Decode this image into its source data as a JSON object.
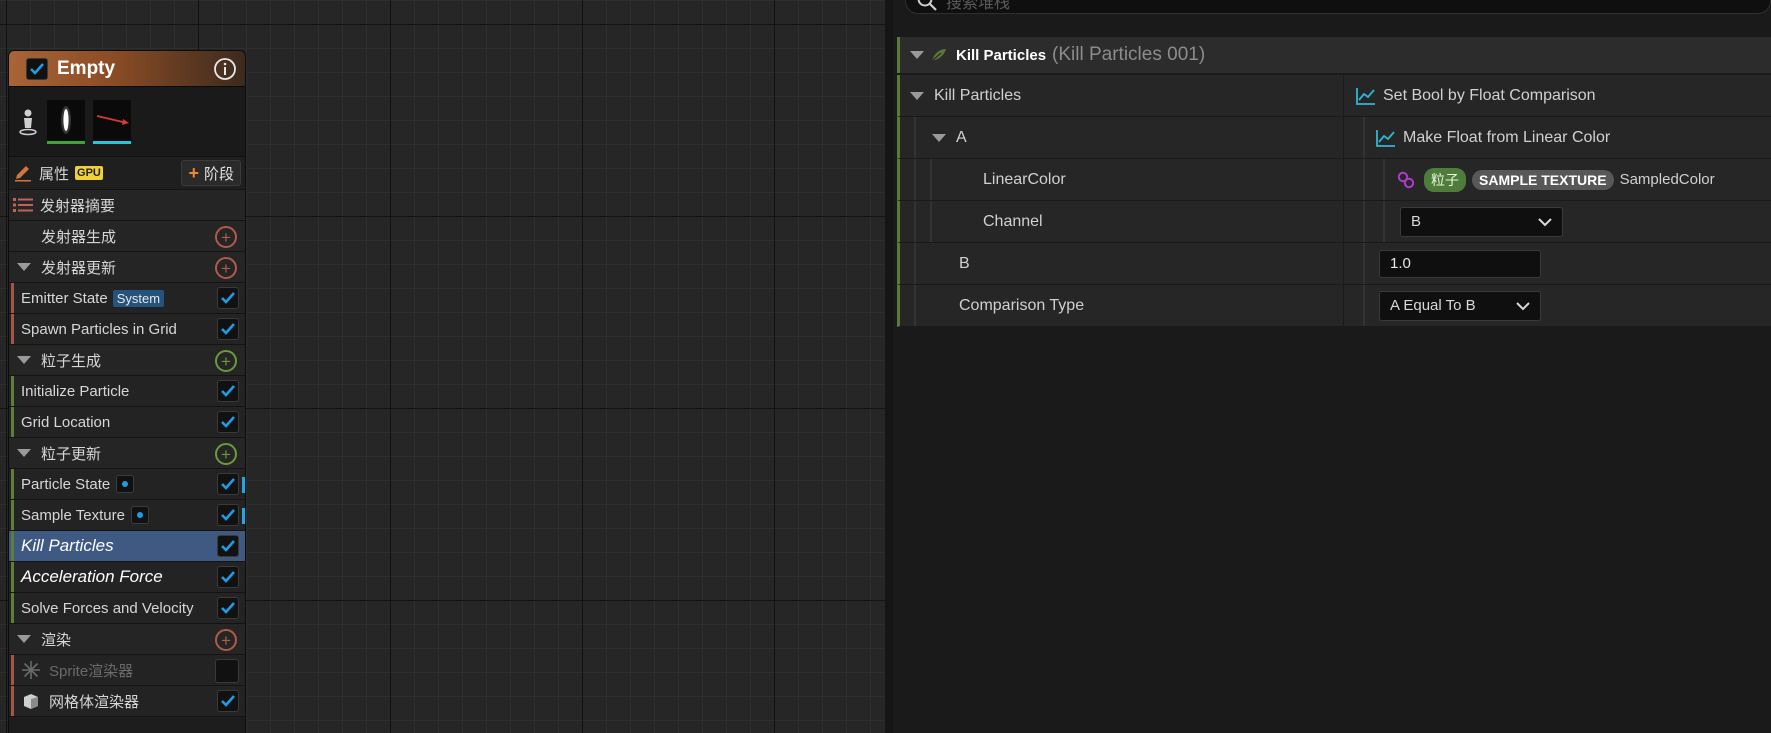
{
  "emitter_node": {
    "title": "Empty",
    "toolbar": {
      "properties_label": "属性",
      "gpu_badge": "GPU",
      "stage_label": "阶段"
    },
    "summary_label": "发射器摘要",
    "sections": {
      "emitter_spawn": "发射器生成",
      "emitter_update": "发射器更新",
      "particle_spawn": "粒子生成",
      "particle_update": "粒子更新",
      "render": "渲染"
    },
    "items": {
      "emitter_state": "Emitter State",
      "system_tag": "System",
      "spawn_grid": "Spawn Particles in Grid",
      "init_particle": "Initialize Particle",
      "grid_location": "Grid Location",
      "particle_state": "Particle State",
      "sample_texture": "Sample Texture",
      "kill_particles": "Kill Particles",
      "acceleration_force": "Acceleration Force",
      "solve_forces": "Solve Forces and Velocity",
      "sprite_renderer": "Sprite渲染器",
      "mesh_renderer": "网格体渲染器"
    }
  },
  "details": {
    "search_placeholder": "搜索堆栈",
    "header_title": "Kill Particles",
    "header_sub": "(Kill Particles 001)",
    "rows": {
      "kill_particles_name": "Kill Particles",
      "kill_particles_value": "Set Bool by Float Comparison",
      "a_name": "A",
      "a_value": "Make Float from Linear Color",
      "linear_color_name": "LinearColor",
      "linear_color_pill1": "粒子",
      "linear_color_pill2": "SAMPLE TEXTURE",
      "linear_color_value": "SampledColor",
      "channel_name": "Channel",
      "channel_value": "B",
      "b_name": "B",
      "b_value": "1.0",
      "comparison_name": "Comparison Type",
      "comparison_value": "A Equal To B"
    }
  },
  "colors": {
    "accent_selected": "#3e5a82",
    "check_blue": "#1e9de6",
    "stage_orange": "#f08a2a",
    "section_green": "#5a7a3a"
  }
}
